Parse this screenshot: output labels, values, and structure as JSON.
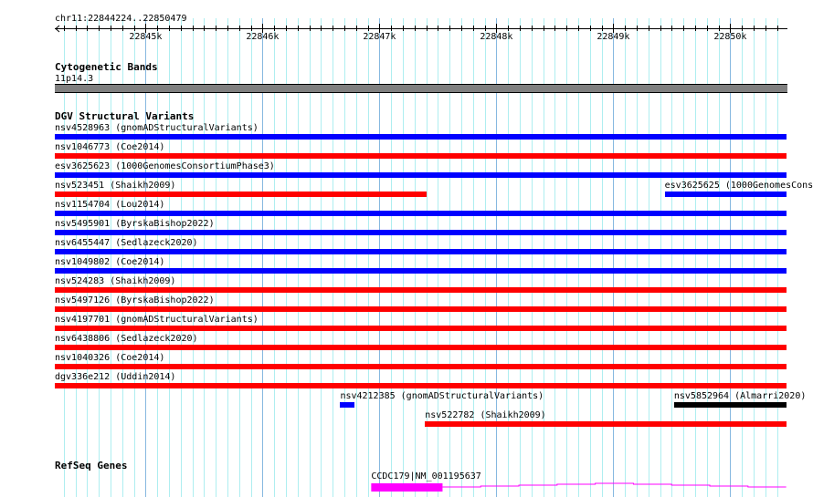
{
  "region": "chr11:22844224..22850479",
  "region_start": 22844224,
  "region_end": 22850479,
  "ruler_labels": [
    "22845k",
    "22846k",
    "22847k",
    "22848k",
    "22849k",
    "22850k"
  ],
  "colors": {
    "blue": "#0000ff",
    "red": "#ff0000",
    "black": "#000000",
    "gene": "#ff00ff",
    "band": "#808080",
    "grid_minor": "#aeeef0",
    "grid_major": "#86b8e0"
  },
  "tracks": {
    "cyto": {
      "title": "Cytogenetic Bands",
      "band": "11p14.3"
    },
    "dgv": {
      "title": "DGV Structural Variants",
      "features": [
        {
          "label": "nsv4528963 (gnomADStructuralVariants)",
          "color": "blue",
          "start": 22844224,
          "end": 22850479,
          "row": 0
        },
        {
          "label": "nsv1046773 (Coe2014)",
          "color": "red",
          "start": 22844224,
          "end": 22850479,
          "row": 1
        },
        {
          "label": "esv3625623 (1000GenomesConsortiumPhase3)",
          "color": "blue",
          "start": 22844224,
          "end": 22850479,
          "row": 2
        },
        {
          "label": "nsv523451 (Shaikh2009)",
          "color": "red",
          "start": 22844224,
          "end": 22847400,
          "row": 3
        },
        {
          "label": "esv3625625 (1000GenomesCons",
          "color": "blue",
          "start": 22849440,
          "end": 22850479,
          "row": 3
        },
        {
          "label": "nsv1154704 (Lou2014)",
          "color": "blue",
          "start": 22844224,
          "end": 22850479,
          "row": 4
        },
        {
          "label": "nsv5495901 (ByrskaBishop2022)",
          "color": "blue",
          "start": 22844224,
          "end": 22850479,
          "row": 5
        },
        {
          "label": "nsv6455447 (Sedlazeck2020)",
          "color": "blue",
          "start": 22844224,
          "end": 22850479,
          "row": 6
        },
        {
          "label": "nsv1049802 (Coe2014)",
          "color": "blue",
          "start": 22844224,
          "end": 22850479,
          "row": 7
        },
        {
          "label": "nsv524283 (Shaikh2009)",
          "color": "red",
          "start": 22844224,
          "end": 22850479,
          "row": 8
        },
        {
          "label": "nsv5497126 (ByrskaBishop2022)",
          "color": "red",
          "start": 22844224,
          "end": 22850479,
          "row": 9
        },
        {
          "label": "nsv4197701 (gnomADStructuralVariants)",
          "color": "red",
          "start": 22844224,
          "end": 22850479,
          "row": 10
        },
        {
          "label": "nsv6438806 (Sedlazeck2020)",
          "color": "red",
          "start": 22844224,
          "end": 22850479,
          "row": 11
        },
        {
          "label": "nsv1040326 (Coe2014)",
          "color": "red",
          "start": 22844224,
          "end": 22850479,
          "row": 12
        },
        {
          "label": "dgv336e212 (Uddin2014)",
          "color": "red",
          "start": 22844224,
          "end": 22850479,
          "row": 13
        },
        {
          "label": "nsv4212385 (gnomADStructuralVariants)",
          "color": "blue",
          "start": 22846665,
          "end": 22846790,
          "row": 14
        },
        {
          "label": "nsv5852964 (Almarri2020)",
          "color": "black",
          "start": 22849520,
          "end": 22850479,
          "row": 14
        },
        {
          "label": "nsv522782 (Shaikh2009)",
          "color": "red",
          "start": 22847390,
          "end": 22850479,
          "row": 15
        }
      ]
    },
    "refseq": {
      "title": "RefSeq Genes",
      "gene": {
        "label": "CCDC179|NM_001195637",
        "start": 22846930,
        "end": 22850479,
        "thick_end": 22847540
      }
    }
  }
}
